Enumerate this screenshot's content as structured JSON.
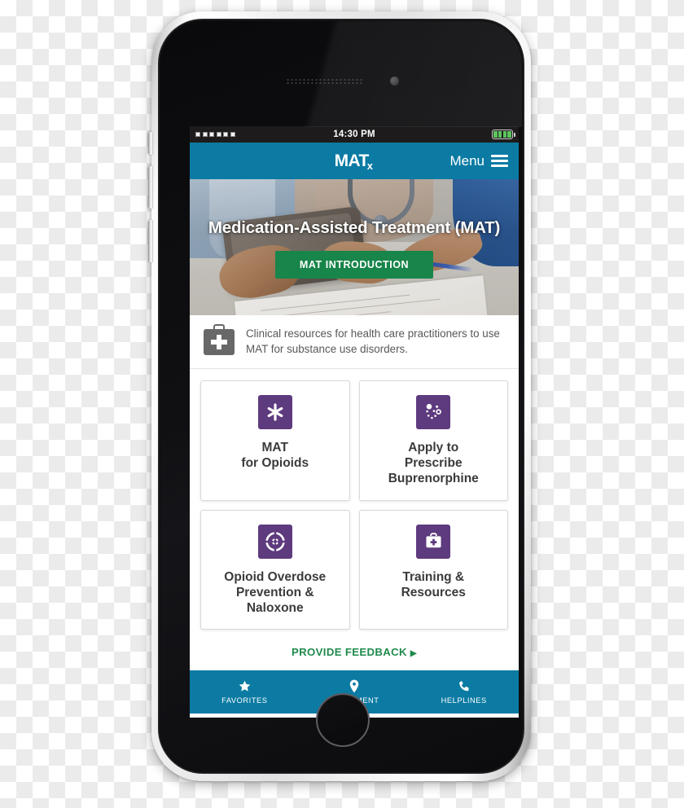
{
  "device": {
    "type": "smartphone-mockup",
    "home_button": "home-button"
  },
  "status_bar": {
    "signal_label": "signal-strength",
    "time": "14:30 PM",
    "battery_label": "battery-full"
  },
  "header": {
    "logo_main": "MAT",
    "logo_sub": "x",
    "menu_label": "Menu"
  },
  "hero": {
    "title": "Medication-Assisted Treatment (MAT)",
    "cta_label": "MAT INTRODUCTION"
  },
  "description": {
    "icon": "medical-bag-icon",
    "text": "Clinical resources for health care practitioners to use MAT for substance use disorders."
  },
  "tiles": [
    {
      "label": "MAT\nfor Opioids",
      "icon": "asterisk-icon",
      "color": "#5e3a7e"
    },
    {
      "label": "Apply to Prescribe Buprenorphine",
      "icon": "molecule-icon",
      "color": "#5e3a7e"
    },
    {
      "label": "Opioid Overdose Prevention & Naloxone",
      "icon": "life-ring-icon",
      "color": "#5e3a7e"
    },
    {
      "label": "Training & Resources",
      "icon": "medical-bag-icon",
      "color": "#5e3a7e"
    }
  ],
  "feedback": {
    "label": "PROVIDE FEEDBACK",
    "caret": "▶"
  },
  "bottom_nav": [
    {
      "label": "FAVORITES",
      "icon": "star-icon"
    },
    {
      "label": "TREATMENT",
      "icon": "map-pin-icon"
    },
    {
      "label": "HELPLINES",
      "icon": "phone-icon"
    }
  ],
  "colors": {
    "brand_teal": "#0b7ba3",
    "cta_green": "#18854a",
    "link_green": "#1f8a4c",
    "tile_purple": "#5e3a7e",
    "status_bar": "#1d1b1b"
  }
}
